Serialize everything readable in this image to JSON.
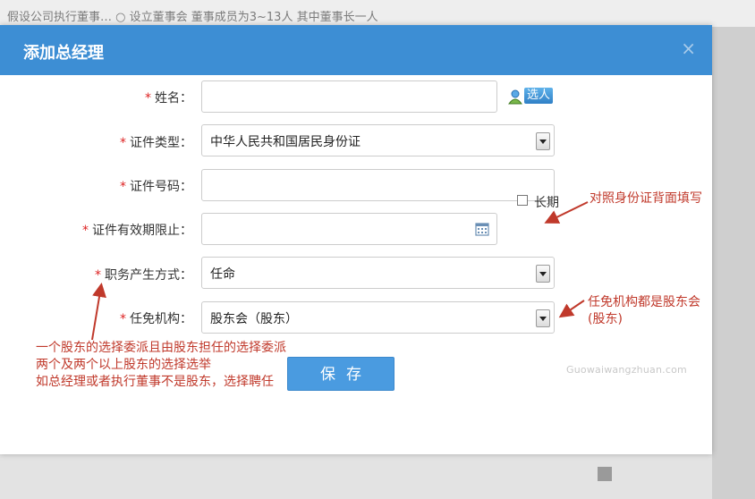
{
  "background": {
    "top_text": "假设公司执行董事…  ○ 设立董事会  董事成员为3~13人 其中董事长一人"
  },
  "dialog": {
    "title": "添加总经理",
    "close_symbol": "×"
  },
  "form": {
    "required_mark": "*",
    "fields": [
      {
        "label": "姓名：",
        "value": ""
      },
      {
        "label": "证件类型：",
        "value": "中华人民共和国居民身份证"
      },
      {
        "label": "证件号码：",
        "value": ""
      },
      {
        "label": "证件有效期限止：",
        "value": ""
      },
      {
        "label": "职务产生方式：",
        "value": "任命"
      },
      {
        "label": "任免机构：",
        "value": "股东会（股东）"
      }
    ],
    "select_button_label": "选人",
    "long_term_label": "长期",
    "long_term_checked": false,
    "save_label": "保存"
  },
  "annotations": {
    "id_back": "对照身份证背面填写",
    "appoint_body_line1": "任免机构都是股东会",
    "appoint_body_line2": "(股东)",
    "method_line1": "一个股东的选择委派且由股东担任的选择委派",
    "method_line2": "两个及两个以上股东的选择选举",
    "method_line3": "如总经理或者执行董事不是股东，选择聘任"
  },
  "watermark": "Guowaiwangzhuan.com",
  "colors": {
    "header": "#3d8ed4",
    "save_button": "#4a9be0",
    "required": "#dd2222",
    "annotation": "#c0392b"
  },
  "icons": [
    "close-icon",
    "user-select-icon",
    "dropdown-arrow-icon",
    "calendar-icon",
    "checkbox"
  ]
}
